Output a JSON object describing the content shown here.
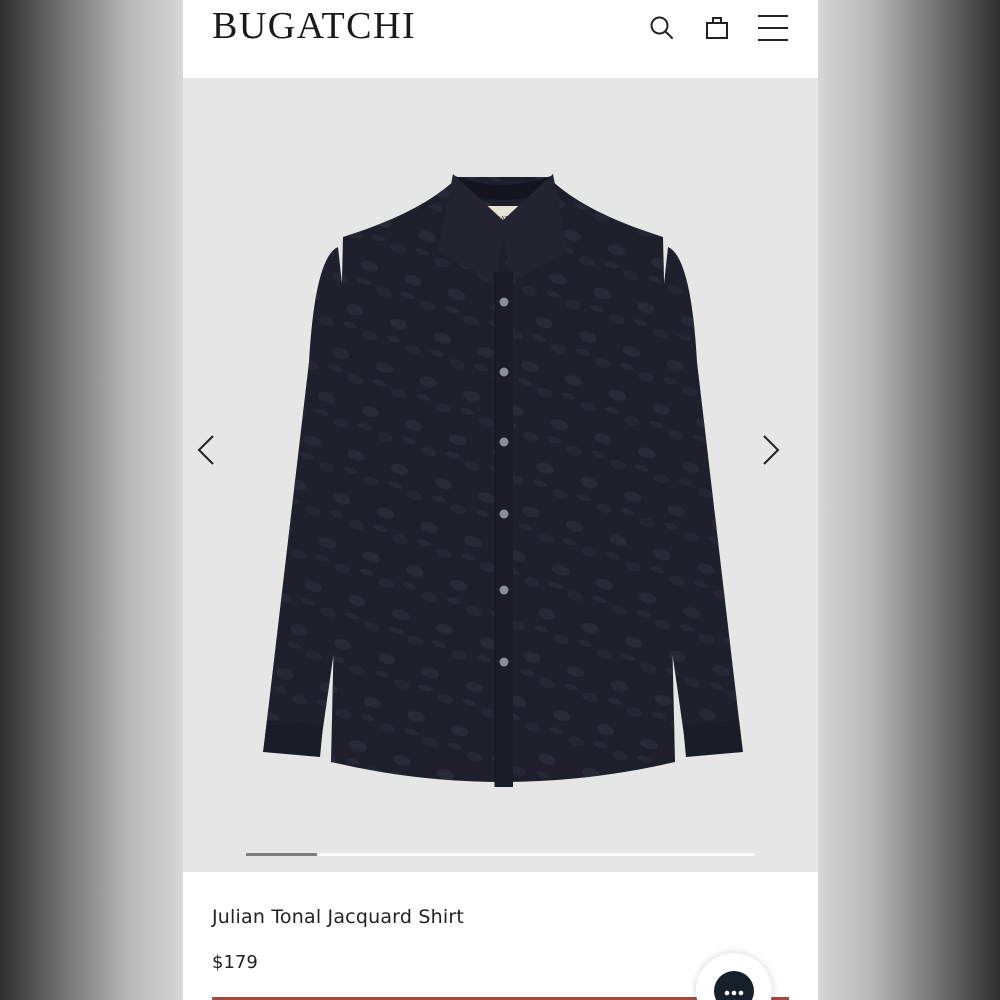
{
  "header": {
    "brand": "BUGATCHI",
    "icons": [
      "search-icon",
      "shopping-bag-icon",
      "hamburger-menu-icon"
    ]
  },
  "gallery": {
    "image": "navy tonal jacquard long-sleeve shirt",
    "label_text": "BUGATCHI",
    "prev_icon": "chevron-left-icon",
    "next_icon": "chevron-right-icon",
    "progress_fraction": 0.14
  },
  "product": {
    "name": "Julian Tonal Jacquard Shirt",
    "price": "$179"
  },
  "chat": {
    "icon": "chat-ellipsis-icon"
  },
  "colors": {
    "shirt": "#1d1f2b",
    "gallery_bg": "#e6e6e7",
    "accent_button": "#a24c3f",
    "chat_bg": "#16202a"
  }
}
